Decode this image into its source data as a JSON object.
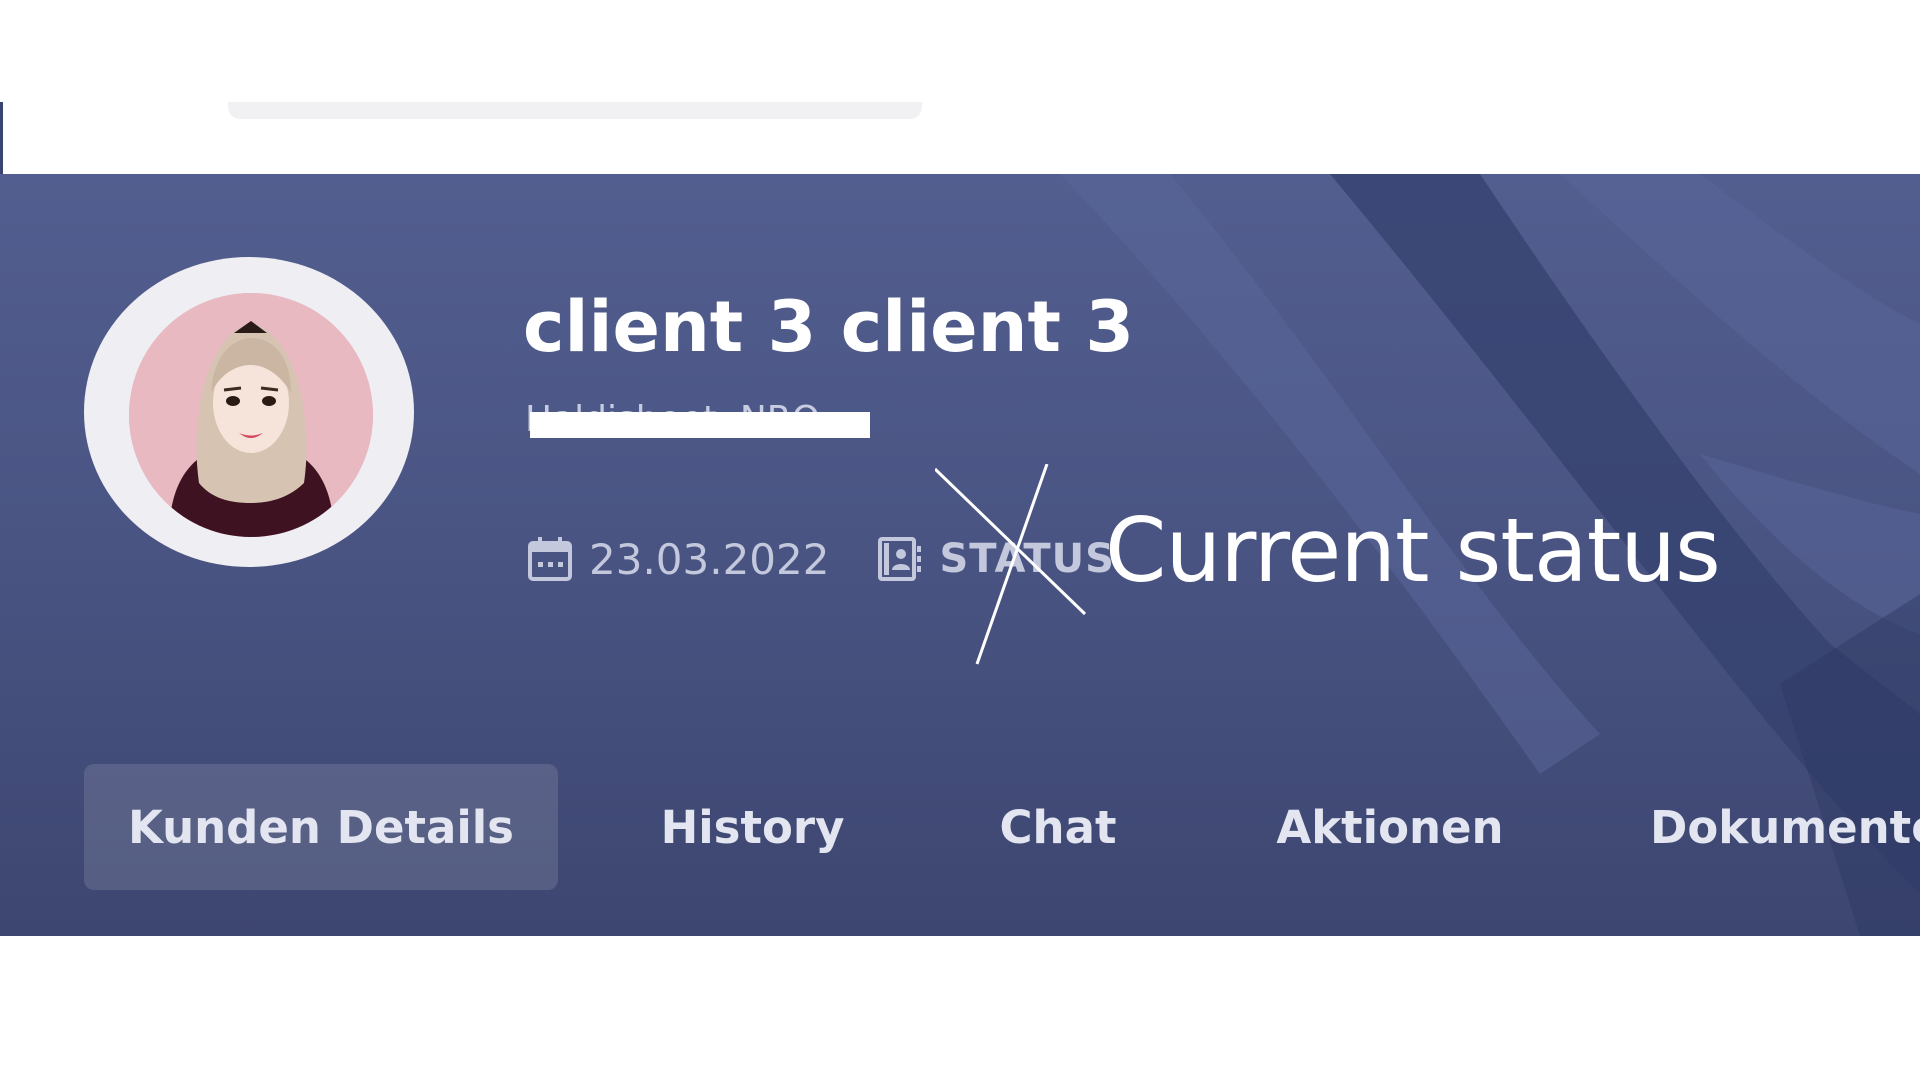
{
  "header": {
    "search_placeholder": ""
  },
  "client": {
    "name": "client 3 client 3",
    "address": "Haldisheet, NRO",
    "date": "23.03.2022",
    "status_label": "STATUS"
  },
  "annotation": {
    "text": "Current status"
  },
  "tabs": [
    {
      "label": "Kunden Details",
      "active": true
    },
    {
      "label": "History",
      "active": false
    },
    {
      "label": "Chat",
      "active": false
    },
    {
      "label": "Aktionen",
      "active": false
    },
    {
      "label": "Dokumente",
      "active": false
    }
  ],
  "icons": {
    "calendar": "calendar-icon",
    "contact_card": "contact-card-icon"
  },
  "colors": {
    "banner_top": "#525e8f",
    "banner_bottom": "#3d4670",
    "text_white": "#ffffff",
    "text_muted": "#c3c8dc",
    "avatar_bg": "#e9b9c2"
  }
}
